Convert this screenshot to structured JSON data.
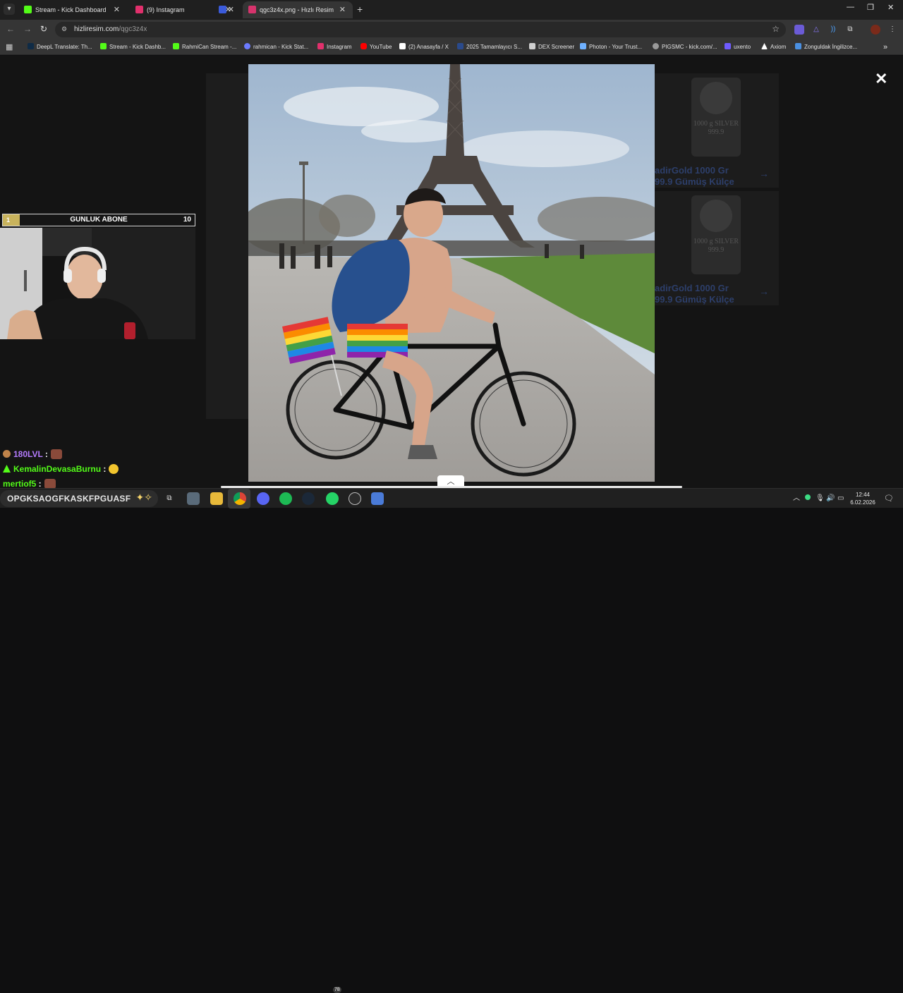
{
  "browser": {
    "tabs": [
      {
        "label": "Stream - Kick Dashboard",
        "favicon_color": "#53fc18",
        "active": false
      },
      {
        "label": "(9) Instagram",
        "favicon_color": "#e1306c",
        "active": false
      },
      {
        "label": "",
        "favicon_color": "#3b5bdb",
        "active": false
      },
      {
        "label": "qgc3z4x.png - Hızlı Resim",
        "favicon_color": "#d6336c",
        "active": true
      }
    ],
    "new_tab_icon": "plus-icon",
    "window_controls": [
      "minimize-icon",
      "restore-icon",
      "close-icon"
    ],
    "url_host": "hizliresim.com",
    "url_path": "/qgc3z4x",
    "bookmarks": [
      {
        "label": "DeepL Translate: Th...",
        "color": "#0f2b46"
      },
      {
        "label": "Stream - Kick Dashb...",
        "color": "#53fc18"
      },
      {
        "label": "RahmiCan Stream -...",
        "color": "#53fc18"
      },
      {
        "label": "rahmican - Kick Stat...",
        "color": "#6c7bff"
      },
      {
        "label": "Instagram",
        "color": "#e1306c"
      },
      {
        "label": "YouTube",
        "color": "#ff0000"
      },
      {
        "label": "(2) Anasayfa / X",
        "color": "#ffffff"
      },
      {
        "label": "2025 Tamamlayıcı S...",
        "color": "#2a4a8c"
      },
      {
        "label": "DEX Screener",
        "color": "#cfcfcf"
      },
      {
        "label": "Photon - Your Trust...",
        "color": "#6fb1ff"
      },
      {
        "label": "PIGSMC - kick.com/...",
        "color": "#9a9a9a"
      },
      {
        "label": "uxento",
        "color": "#6f5bff"
      },
      {
        "label": "Axiom",
        "color": "#ffffff"
      },
      {
        "label": "Zonguldak İngilizce...",
        "color": "#4a90e2"
      }
    ]
  },
  "page": {
    "ads": [
      {
        "title_line1": "adirGold 1000 Gr",
        "title_line2": "99.9 Gümüş Külçe",
        "bar_text": "1000 g SILVER 999.9"
      },
      {
        "title_line1": "adirGold 1000 Gr",
        "title_line2": "99.9 Gümüş Külçe",
        "bar_text": "1000 g SILVER 999.9"
      }
    ],
    "close_icon": "close-icon",
    "scroll_up_icon": "chevron-up-icon"
  },
  "overlay": {
    "sub_goal": {
      "rank": "1",
      "title": "GUNLUK ABONE",
      "count": "10"
    },
    "chat": [
      {
        "user": "180LVL",
        "color": "#b57cff",
        "badge_color": "#c0834a"
      },
      {
        "user": "KemalinDevasaBurnu",
        "color": "#53fc18",
        "badge_color": "#53fc18"
      },
      {
        "user": "mertiof5",
        "color": "#53fc18",
        "badge_color": ""
      }
    ]
  },
  "taskbar": {
    "search_text": "OPGKSAOGFKASKFPGUASF",
    "whatsapp_badge": "78",
    "time": "12:44",
    "date": "6.02.2026"
  }
}
